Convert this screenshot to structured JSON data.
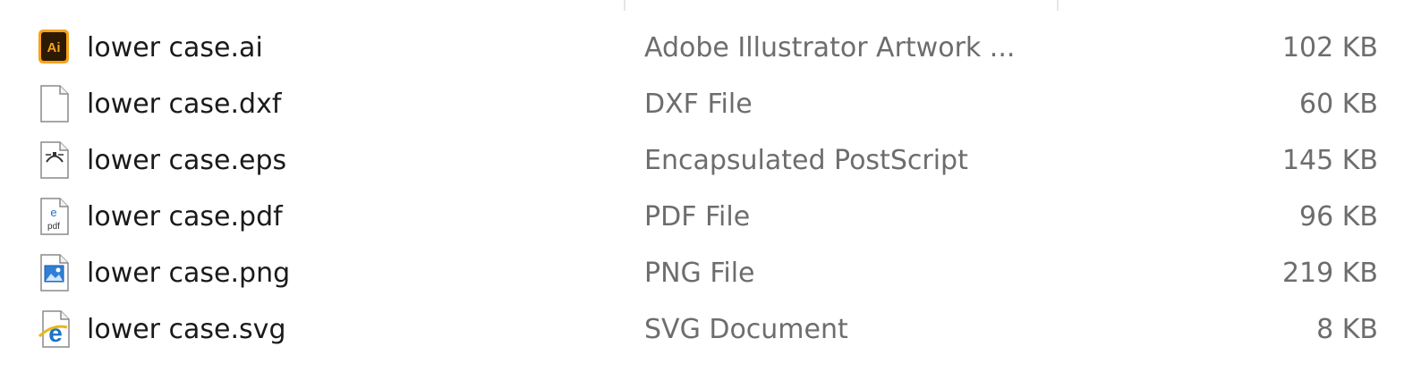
{
  "files": [
    {
      "name": "lower case.ai",
      "type": "Adobe Illustrator Artwork ...",
      "size": "102 KB",
      "icon": "illustrator-file-icon"
    },
    {
      "name": "lower case.dxf",
      "type": "DXF File",
      "size": "60 KB",
      "icon": "generic-file-icon"
    },
    {
      "name": "lower case.eps",
      "type": "Encapsulated PostScript",
      "size": "145 KB",
      "icon": "eps-file-icon"
    },
    {
      "name": "lower case.pdf",
      "type": "PDF File",
      "size": "96 KB",
      "icon": "pdf-file-icon"
    },
    {
      "name": "lower case.png",
      "type": "PNG File",
      "size": "219 KB",
      "icon": "png-image-file-icon"
    },
    {
      "name": "lower case.svg",
      "type": "SVG Document",
      "size": "8 KB",
      "icon": "internet-explorer-svg-file-icon"
    }
  ],
  "colors": {
    "name_text": "#1a1a1a",
    "detail_text": "#6d6d6d",
    "illustrator_bg": "#2d1a02",
    "illustrator_accent": "#f7a21b",
    "ie_blue": "#1e73c8",
    "ie_gold": "#e9b71c"
  }
}
